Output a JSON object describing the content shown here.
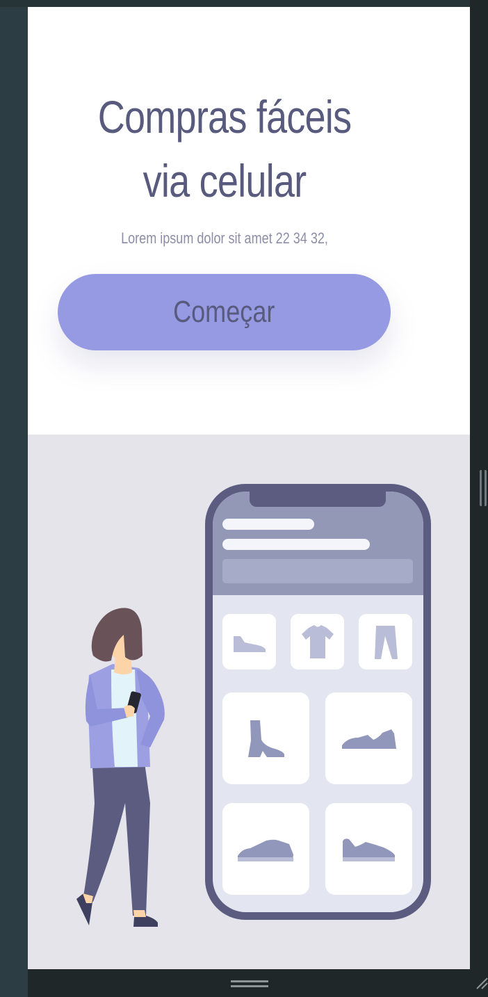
{
  "hero": {
    "title_line1": "Compras fáceis",
    "title_line2": "via celular",
    "subtitle": "Lorem ipsum dolor sit amet 22 34 32,",
    "cta_label": "Começar"
  },
  "illustration": {
    "phone_categories": [
      "shoe-icon",
      "tshirt-icon",
      "pants-icon"
    ],
    "phone_products": [
      "boot-icon",
      "sneaker-icon",
      "sneaker-icon",
      "sneaker-icon"
    ]
  },
  "colors": {
    "accent": "#959ae3",
    "text": "#585a7e",
    "muted_text": "#8c8ea8",
    "illustration_bg": "#e5e4ea",
    "phone_frame": "#5b5c80"
  }
}
